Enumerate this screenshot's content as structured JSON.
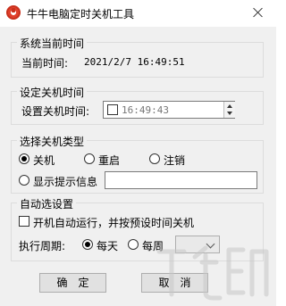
{
  "window": {
    "title": "牛牛电脑定时关机工具"
  },
  "system_time": {
    "group_title": "系统当前时间",
    "label": "当前时间:",
    "value": "2021/2/7 16:49:51"
  },
  "set_time": {
    "group_title": "设定关机时间",
    "label": "设置关机时间:",
    "value": "16:49:43"
  },
  "shutdown_type": {
    "group_title": "选择关机类型",
    "options": [
      {
        "label": "关机",
        "checked": true
      },
      {
        "label": "重启",
        "checked": false
      },
      {
        "label": "注销",
        "checked": false
      },
      {
        "label": "显示提示信息",
        "checked": false
      }
    ],
    "message_value": ""
  },
  "auto": {
    "group_title": "自动选设置",
    "autostart_label": "开机自动运行，并按预设时间关机",
    "period_label": "执行周期:",
    "period_options": [
      {
        "label": "每天",
        "checked": true
      },
      {
        "label": "每周",
        "checked": false
      }
    ],
    "weekday_value": ""
  },
  "buttons": {
    "ok": "确　定",
    "cancel": "取　消"
  },
  "colors": {
    "icon_red": "#e0402c",
    "group_border": "#dcdcdc",
    "window_bg": "#f0f0f0"
  }
}
